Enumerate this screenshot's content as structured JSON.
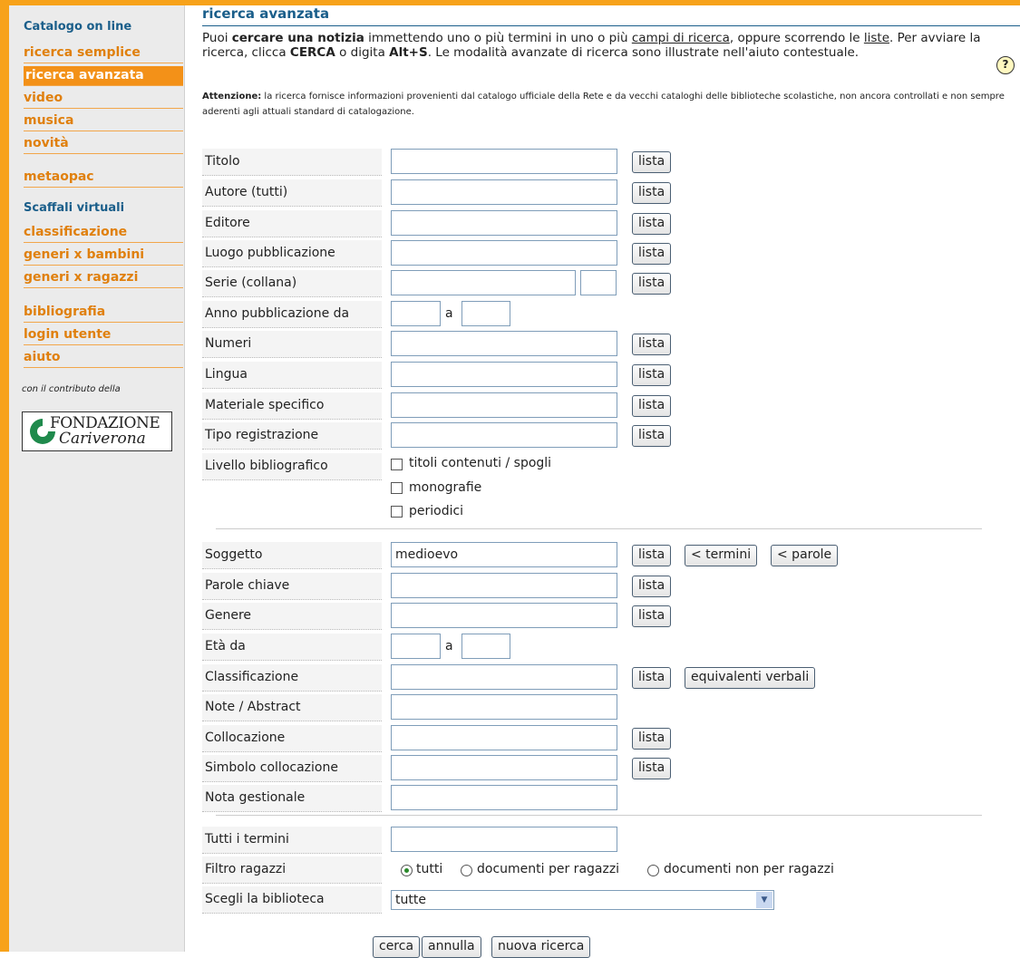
{
  "colors": {
    "accent": "#f39118",
    "brand_blue": "#1a5e8a"
  },
  "sidebar": {
    "heading_catalog": "Catalogo on line",
    "links": {
      "ricerca_semplice": "ricerca semplice",
      "ricerca_avanzata": "ricerca avanzata",
      "video": "video",
      "musica": "musica",
      "novita": "novità",
      "metaopac": "metaopac",
      "classificazione": "classificazione",
      "generi_bambini": "generi x bambini",
      "generi_ragazzi": "generi x ragazzi",
      "bibliografia": "bibliografia",
      "login_utente": "login utente",
      "aiuto": "aiuto"
    },
    "heading_scaffali": "Scaffali virtuali",
    "contributo_note": "con il contributo della",
    "logo": {
      "line1": "FONDAZIONE",
      "line2": "Cariverona"
    }
  },
  "main": {
    "title": "ricerca avanzata",
    "intro": {
      "t1": "Puoi ",
      "b1": "cercare una notizia",
      "t2": " immettendo uno o più termini in uno o più ",
      "u1": "campi di ricerca",
      "t3": ", oppure scorrendo le ",
      "u2": "liste",
      "t4": ". Per avviare la ricerca, clicca ",
      "b2": "CERCA",
      "t5": " o digita ",
      "b3": "Alt+S",
      "t6": ". Le modalità avanzate di ricerca sono illustrate nell'aiuto contestuale."
    },
    "help_icon": "?",
    "warning": {
      "label": "Attenzione:",
      "text": " la ricerca fornisce informazioni provenienti dal catalogo ufficiale della Rete e da vecchi cataloghi delle biblioteche scolastiche, non ancora controllati e non sempre aderenti agli attuali standard di catalogazione."
    }
  },
  "buttons": {
    "lista": "lista",
    "termini": "< termini",
    "parole": "< parole",
    "equivalenti": "equivalenti verbali",
    "cerca": "cerca",
    "annulla": "annulla",
    "nuova": "nuova ricerca"
  },
  "fields": {
    "titolo": "Titolo",
    "autore": "Autore (tutti)",
    "editore": "Editore",
    "luogo": "Luogo pubblicazione",
    "serie": "Serie (collana)",
    "anno": "Anno pubblicazione da",
    "a_label": "a",
    "numeri": "Numeri",
    "lingua": "Lingua",
    "materiale": "Materiale specifico",
    "tipo": "Tipo registrazione",
    "livello": "Livello bibliografico",
    "livello_opts": [
      "titoli contenuti / spogli",
      "monografie",
      "periodici"
    ],
    "soggetto": "Soggetto",
    "soggetto_value": "medioevo",
    "parole_chiave": "Parole chiave",
    "genere": "Genere",
    "eta": "Età da",
    "classificazione": "Classificazione",
    "note": "Note / Abstract",
    "collocazione": "Collocazione",
    "simbolo": "Simbolo collocazione",
    "nota_gestionale": "Nota gestionale",
    "tutti_termini": "Tutti i termini",
    "filtro": "Filtro ragazzi",
    "filtro_opts": [
      "tutti",
      "documenti per ragazzi",
      "documenti non per ragazzi"
    ],
    "biblioteca": "Scegli la biblioteca",
    "biblioteca_value": "tutte"
  }
}
